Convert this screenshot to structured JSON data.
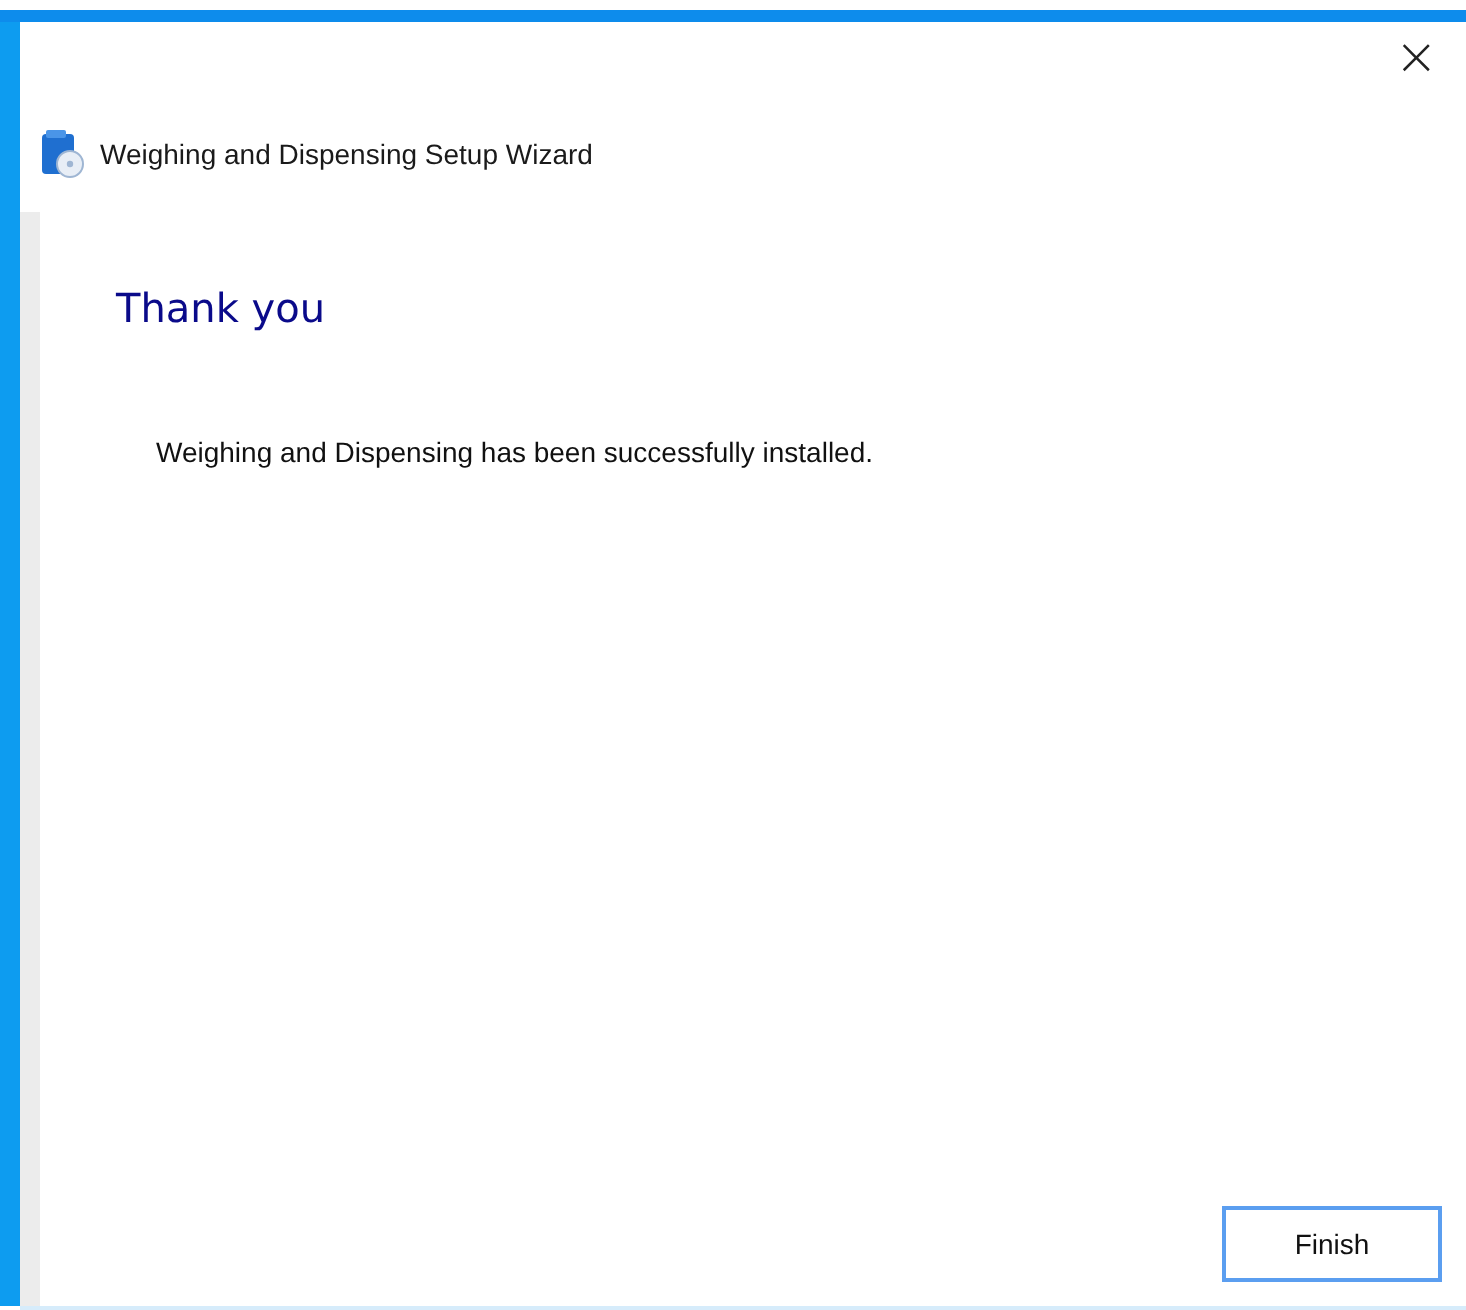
{
  "window": {
    "title": "Weighing and Dispensing Setup Wizard",
    "close": "×"
  },
  "page": {
    "heading": "Thank you",
    "message": "Weighing and Dispensing has been successfully installed."
  },
  "buttons": [
    {
      "label": "Finish",
      "focused": true
    }
  ]
}
